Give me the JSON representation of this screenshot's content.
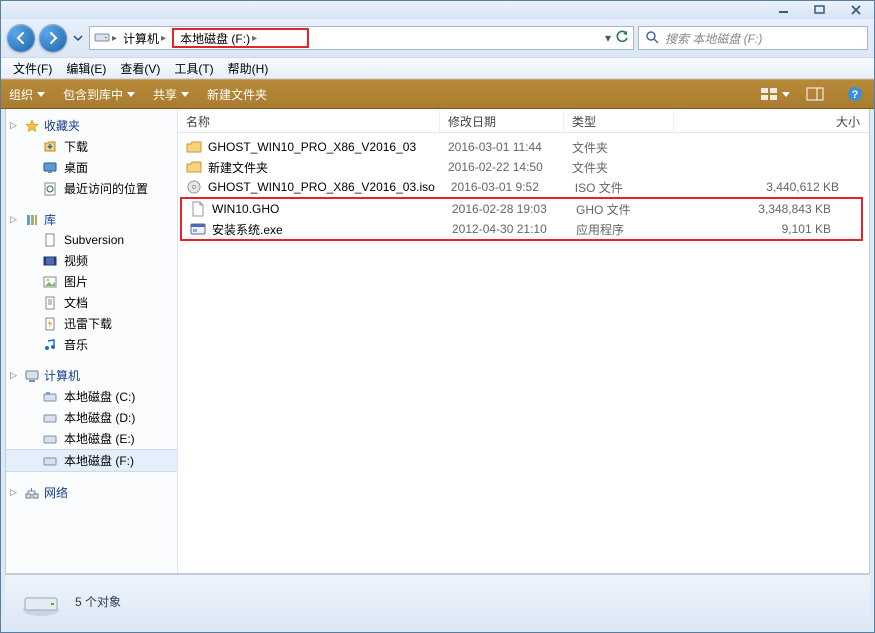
{
  "breadcrumb": {
    "computer": "计算机",
    "drive": "本地磁盘 (F:)"
  },
  "search": {
    "placeholder": "搜索 本地磁盘 (F:)"
  },
  "menu": {
    "file": "文件(F)",
    "edit": "编辑(E)",
    "view": "查看(V)",
    "tools": "工具(T)",
    "help": "帮助(H)"
  },
  "toolbar": {
    "organize": "组织",
    "include": "包含到库中",
    "share": "共享",
    "newfolder": "新建文件夹"
  },
  "sidebar": {
    "favorites": {
      "label": "收藏夹",
      "items": [
        "下载",
        "桌面",
        "最近访问的位置"
      ]
    },
    "libraries": {
      "label": "库",
      "items": [
        "Subversion",
        "视频",
        "图片",
        "文档",
        "迅雷下载",
        "音乐"
      ]
    },
    "computer": {
      "label": "计算机",
      "items": [
        "本地磁盘 (C:)",
        "本地磁盘 (D:)",
        "本地磁盘 (E:)",
        "本地磁盘 (F:)"
      ]
    },
    "network": {
      "label": "网络"
    }
  },
  "columns": {
    "name": "名称",
    "date": "修改日期",
    "type": "类型",
    "size": "大小"
  },
  "files": [
    {
      "name": "GHOST_WIN10_PRO_X86_V2016_03",
      "date": "2016-03-01 11:44",
      "type": "文件夹",
      "size": ""
    },
    {
      "name": "新建文件夹",
      "date": "2016-02-22 14:50",
      "type": "文件夹",
      "size": ""
    },
    {
      "name": "GHOST_WIN10_PRO_X86_V2016_03.iso",
      "date": "2016-03-01 9:52",
      "type": "ISO 文件",
      "size": "3,440,612 KB"
    },
    {
      "name": "WIN10.GHO",
      "date": "2016-02-28 19:03",
      "type": "GHO 文件",
      "size": "3,348,843 KB"
    },
    {
      "name": "安装系统.exe",
      "date": "2012-04-30 21:10",
      "type": "应用程序",
      "size": "9,101 KB"
    }
  ],
  "status": {
    "count": "5 个对象"
  }
}
